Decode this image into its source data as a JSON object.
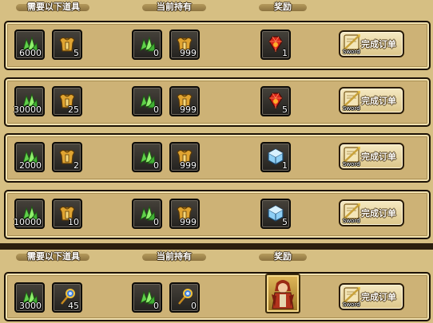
{
  "headers": {
    "required": "需要以下道具",
    "owned": "当前持有",
    "reward": "奖励"
  },
  "button": {
    "label": "完成订单",
    "sub": "Sword"
  },
  "orders": [
    {
      "req": [
        {
          "icon": "green-crystal-icon",
          "count": "6000"
        },
        {
          "icon": "golden-armor-icon",
          "count": "5"
        }
      ],
      "owned": [
        {
          "icon": "green-crystal-icon",
          "count": "0"
        },
        {
          "icon": "golden-armor-icon",
          "count": "999"
        }
      ],
      "reward": {
        "icon": "red-gem-icon",
        "count": "1"
      }
    },
    {
      "req": [
        {
          "icon": "green-crystal-icon",
          "count": "30000"
        },
        {
          "icon": "golden-armor-icon",
          "count": "25"
        }
      ],
      "owned": [
        {
          "icon": "green-crystal-icon",
          "count": "0"
        },
        {
          "icon": "golden-armor-icon",
          "count": "999"
        }
      ],
      "reward": {
        "icon": "red-gem-icon",
        "count": "5"
      }
    },
    {
      "req": [
        {
          "icon": "green-crystal-icon",
          "count": "2000"
        },
        {
          "icon": "golden-armor-icon",
          "count": "2"
        }
      ],
      "owned": [
        {
          "icon": "green-crystal-icon",
          "count": "0"
        },
        {
          "icon": "golden-armor-icon",
          "count": "999"
        }
      ],
      "reward": {
        "icon": "blue-cube-icon",
        "count": "1"
      }
    },
    {
      "req": [
        {
          "icon": "green-crystal-icon",
          "count": "10000"
        },
        {
          "icon": "golden-armor-icon",
          "count": "10"
        }
      ],
      "owned": [
        {
          "icon": "green-crystal-icon",
          "count": "0"
        },
        {
          "icon": "golden-armor-icon",
          "count": "999"
        }
      ],
      "reward": {
        "icon": "blue-cube-icon",
        "count": "5"
      }
    },
    {
      "req": [
        {
          "icon": "green-crystal-icon",
          "count": "3000"
        },
        {
          "icon": "blue-scepter-icon",
          "count": "45"
        }
      ],
      "owned": [
        {
          "icon": "green-crystal-icon",
          "count": "0"
        },
        {
          "icon": "blue-scepter-icon",
          "count": "0"
        }
      ],
      "reward": {
        "icon": "character-portrait-icon",
        "count": ""
      }
    }
  ]
}
